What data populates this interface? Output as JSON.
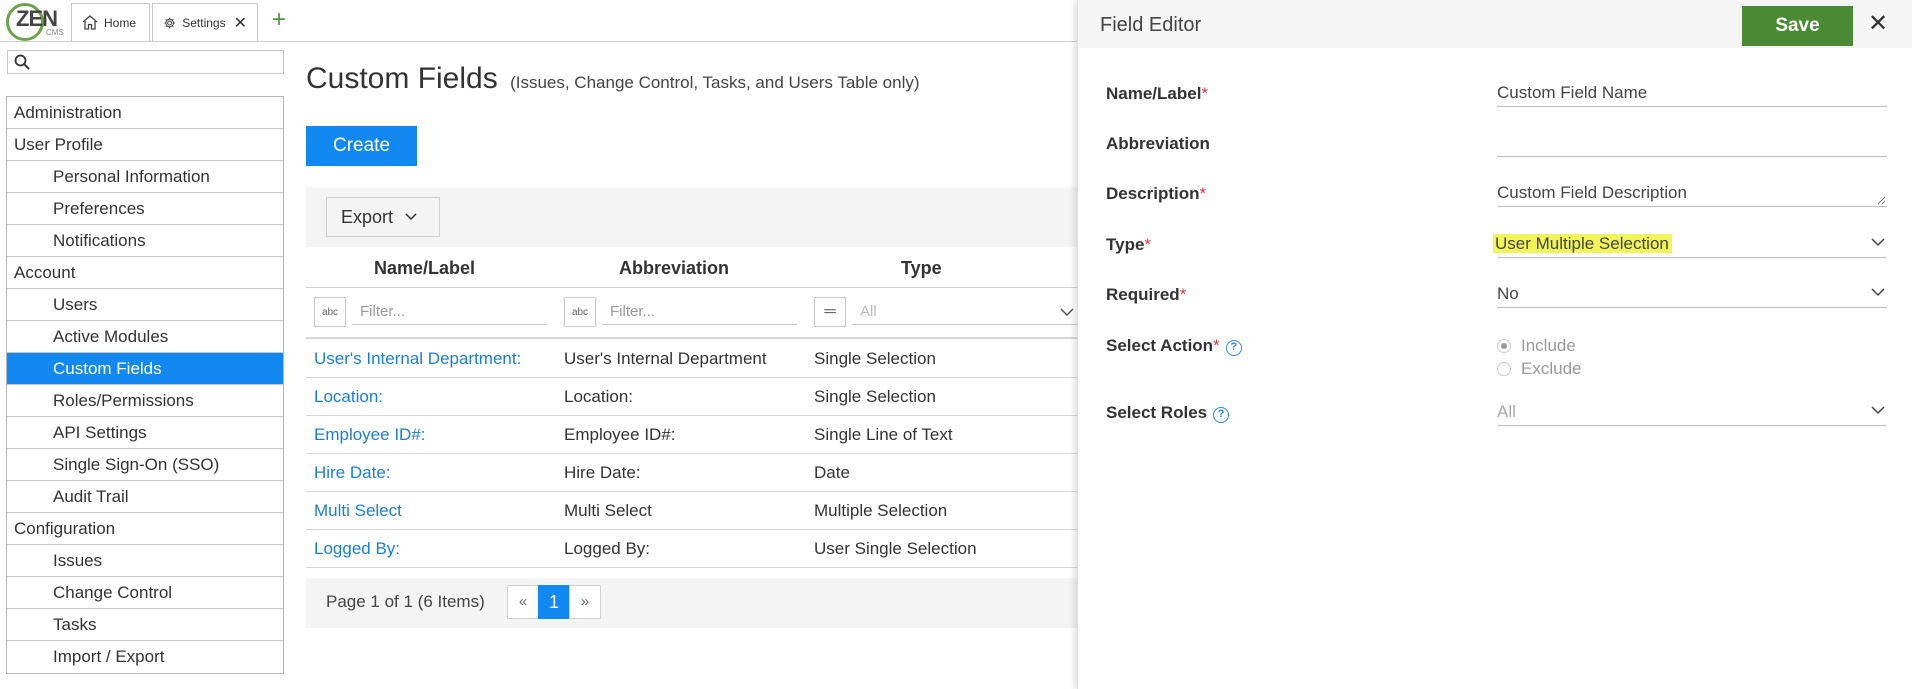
{
  "app": {
    "logo_text": "ZEN",
    "logo_sub": "CMS",
    "tabs": [
      {
        "label": "Home",
        "icon": "home-icon"
      },
      {
        "label": "Settings",
        "icon": "gear-icon"
      }
    ]
  },
  "sidebar": {
    "search_placeholder": "",
    "items": [
      {
        "label": "Administration",
        "level": 0
      },
      {
        "label": "User Profile",
        "level": 0
      },
      {
        "label": "Personal Information",
        "level": 1
      },
      {
        "label": "Preferences",
        "level": 1
      },
      {
        "label": "Notifications",
        "level": 1
      },
      {
        "label": "Account",
        "level": 0
      },
      {
        "label": "Users",
        "level": 1
      },
      {
        "label": "Active Modules",
        "level": 1
      },
      {
        "label": "Custom Fields",
        "level": 1,
        "active": true
      },
      {
        "label": "Roles/Permissions",
        "level": 1
      },
      {
        "label": "API Settings",
        "level": 1
      },
      {
        "label": "Single Sign-On (SSO)",
        "level": 1
      },
      {
        "label": "Audit Trail",
        "level": 1
      },
      {
        "label": "Configuration",
        "level": 0
      },
      {
        "label": "Issues",
        "level": 1
      },
      {
        "label": "Change Control",
        "level": 1
      },
      {
        "label": "Tasks",
        "level": 1
      },
      {
        "label": "Import / Export",
        "level": 1
      }
    ]
  },
  "main": {
    "title": "Custom Fields",
    "subtitle": "(Issues, Change Control, Tasks, and Users Table only)",
    "create_label": "Create",
    "export_label": "Export",
    "columns": [
      "Name/Label",
      "Abbreviation",
      "Type"
    ],
    "filter_placeholder": "Filter...",
    "type_filter_value": "All",
    "rows": [
      {
        "name": "User's Internal Department:",
        "abbr": "User's Internal Department",
        "type": "Single Selection"
      },
      {
        "name": "Location:",
        "abbr": "Location:",
        "type": "Single Selection"
      },
      {
        "name": "Employee ID#:",
        "abbr": "Employee ID#:",
        "type": "Single Line of Text"
      },
      {
        "name": "Hire Date:",
        "abbr": "Hire Date:",
        "type": "Date"
      },
      {
        "name": "Multi Select",
        "abbr": "Multi Select",
        "type": "Multiple Selection"
      },
      {
        "name": "Logged By:",
        "abbr": "Logged By:",
        "type": "User Single Selection"
      }
    ],
    "pager": {
      "text": "Page 1 of 1 (6 Items)",
      "prev": "«",
      "current": "1",
      "next": "»"
    }
  },
  "editor": {
    "title": "Field Editor",
    "save_label": "Save",
    "required_mark": "*",
    "fields": {
      "name_label": "Name/Label",
      "name_value": "Custom Field Name",
      "abbr_label": "Abbreviation",
      "abbr_value": "",
      "desc_label": "Description",
      "desc_value": "Custom Field Description",
      "type_label": "Type",
      "type_value": "User Multiple Selection",
      "required_label": "Required",
      "required_value": "No",
      "action_label": "Select Action",
      "action_options": [
        "Include",
        "Exclude"
      ],
      "action_selected": "Include",
      "roles_label": "Select Roles",
      "roles_value": "All"
    },
    "highlight_color": "#f2f55a",
    "save_color": "#4a8a34"
  },
  "colors": {
    "accent": "#1289f0",
    "link": "#1c7ed6",
    "required": "#d9363e"
  }
}
